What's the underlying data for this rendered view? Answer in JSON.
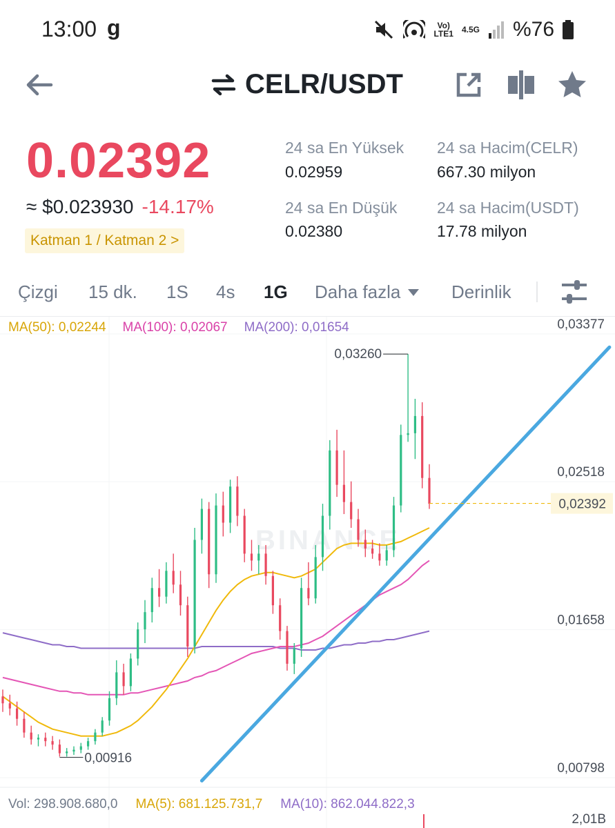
{
  "status_bar": {
    "time": "13:00",
    "carrier_icon": "g",
    "volte": "Vo)\nLTE1",
    "network": "4.5G",
    "battery": "%76",
    "icons": [
      "mute-icon",
      "hotspot-icon",
      "signal-icon",
      "battery-icon"
    ]
  },
  "header": {
    "pair": "CELR/USDT",
    "icons": [
      "back-arrow-icon",
      "swap-icon",
      "share-icon",
      "split-view-icon",
      "star-icon"
    ]
  },
  "price": {
    "last": "0.02392",
    "usd_equiv": "≈ $0.023930",
    "change_pct": "-14.17%",
    "layer_badge": "Katman 1 / Katman 2 >"
  },
  "stats": {
    "high_label": "24 sa En Yüksek",
    "high_value": "0.02959",
    "low_label": "24 sa En Düşük",
    "low_value": "0.02380",
    "vol_base_label": "24 sa Hacim(CELR)",
    "vol_base_value": "667.30 milyon",
    "vol_quote_label": "24 sa Hacim(USDT)",
    "vol_quote_value": "17.78 milyon"
  },
  "tabs": {
    "line": "Çizgi",
    "m15": "15 dk.",
    "h1": "1S",
    "h4": "4s",
    "d1": "1G",
    "more": "Daha fazla",
    "depth": "Derinlik",
    "active": "1G"
  },
  "ma_legend": {
    "ma50": "MA(50): 0,02244",
    "ma100": "MA(100): 0,02067",
    "ma200": "MA(200): 0,01654"
  },
  "chart_data": {
    "type": "candlestick",
    "watermark": "BINANCE",
    "y_ticks": [
      "0,03377",
      "0,02518",
      "0,01658",
      "0,00798"
    ],
    "y_tick_values": [
      0.03377,
      0.02518,
      0.01658,
      0.00798
    ],
    "ylim": [
      0.00798,
      0.03377
    ],
    "current_price_label": "0,02392",
    "current_price": 0.02392,
    "high_annotation": "0,03260",
    "high_value": 0.0326,
    "low_annotation": "0,00916",
    "low_value": 0.00916,
    "colors": {
      "up": "#2ebd85",
      "down": "#e9485f",
      "ma50": "#f0b90b",
      "ma100": "#e455b5",
      "ma200": "#8e6cc7",
      "trendline": "#4aa8e0"
    },
    "candles": [
      {
        "o": 0.0127,
        "h": 0.0131,
        "l": 0.0118,
        "c": 0.0123
      },
      {
        "o": 0.0123,
        "h": 0.0128,
        "l": 0.0116,
        "c": 0.012
      },
      {
        "o": 0.012,
        "h": 0.0124,
        "l": 0.011,
        "c": 0.0114
      },
      {
        "o": 0.0114,
        "h": 0.0118,
        "l": 0.0103,
        "c": 0.0106
      },
      {
        "o": 0.0106,
        "h": 0.011,
        "l": 0.0099,
        "c": 0.0102
      },
      {
        "o": 0.0102,
        "h": 0.0105,
        "l": 0.0098,
        "c": 0.0103
      },
      {
        "o": 0.0103,
        "h": 0.0106,
        "l": 0.0098,
        "c": 0.0101
      },
      {
        "o": 0.0101,
        "h": 0.0104,
        "l": 0.0096,
        "c": 0.0099
      },
      {
        "o": 0.0099,
        "h": 0.0102,
        "l": 0.0092,
        "c": 0.0094
      },
      {
        "o": 0.0094,
        "h": 0.0097,
        "l": 0.0092,
        "c": 0.0095
      },
      {
        "o": 0.0095,
        "h": 0.0098,
        "l": 0.0093,
        "c": 0.0096
      },
      {
        "o": 0.0096,
        "h": 0.01,
        "l": 0.0094,
        "c": 0.0098
      },
      {
        "o": 0.0098,
        "h": 0.0103,
        "l": 0.0096,
        "c": 0.0101
      },
      {
        "o": 0.0101,
        "h": 0.0108,
        "l": 0.0099,
        "c": 0.0106
      },
      {
        "o": 0.0106,
        "h": 0.0115,
        "l": 0.0104,
        "c": 0.0113
      },
      {
        "o": 0.0113,
        "h": 0.013,
        "l": 0.011,
        "c": 0.0126
      },
      {
        "o": 0.0126,
        "h": 0.0148,
        "l": 0.0122,
        "c": 0.0141
      },
      {
        "o": 0.0141,
        "h": 0.0146,
        "l": 0.0128,
        "c": 0.0133
      },
      {
        "o": 0.0133,
        "h": 0.0152,
        "l": 0.013,
        "c": 0.0149
      },
      {
        "o": 0.0149,
        "h": 0.017,
        "l": 0.0145,
        "c": 0.0166
      },
      {
        "o": 0.0166,
        "h": 0.0183,
        "l": 0.0158,
        "c": 0.0176
      },
      {
        "o": 0.0176,
        "h": 0.0196,
        "l": 0.017,
        "c": 0.019
      },
      {
        "o": 0.019,
        "h": 0.0201,
        "l": 0.0179,
        "c": 0.0185
      },
      {
        "o": 0.0185,
        "h": 0.0205,
        "l": 0.0181,
        "c": 0.02
      },
      {
        "o": 0.02,
        "h": 0.021,
        "l": 0.0187,
        "c": 0.0192
      },
      {
        "o": 0.0192,
        "h": 0.02,
        "l": 0.0174,
        "c": 0.018
      },
      {
        "o": 0.018,
        "h": 0.0185,
        "l": 0.015,
        "c": 0.0156
      },
      {
        "o": 0.0156,
        "h": 0.0225,
        "l": 0.0152,
        "c": 0.0218
      },
      {
        "o": 0.0218,
        "h": 0.0242,
        "l": 0.021,
        "c": 0.0236
      },
      {
        "o": 0.0236,
        "h": 0.024,
        "l": 0.019,
        "c": 0.0198
      },
      {
        "o": 0.0198,
        "h": 0.0245,
        "l": 0.0193,
        "c": 0.0238
      },
      {
        "o": 0.0238,
        "h": 0.0246,
        "l": 0.022,
        "c": 0.0228
      },
      {
        "o": 0.0228,
        "h": 0.0253,
        "l": 0.0222,
        "c": 0.0249
      },
      {
        "o": 0.0249,
        "h": 0.0255,
        "l": 0.0226,
        "c": 0.0232
      },
      {
        "o": 0.0232,
        "h": 0.0236,
        "l": 0.0205,
        "c": 0.021
      },
      {
        "o": 0.021,
        "h": 0.0218,
        "l": 0.02,
        "c": 0.0206
      },
      {
        "o": 0.0206,
        "h": 0.0215,
        "l": 0.0198,
        "c": 0.021
      },
      {
        "o": 0.021,
        "h": 0.0215,
        "l": 0.0192,
        "c": 0.0197
      },
      {
        "o": 0.0197,
        "h": 0.02,
        "l": 0.0175,
        "c": 0.018
      },
      {
        "o": 0.018,
        "h": 0.0184,
        "l": 0.016,
        "c": 0.0165
      },
      {
        "o": 0.0165,
        "h": 0.0168,
        "l": 0.0142,
        "c": 0.0146
      },
      {
        "o": 0.0146,
        "h": 0.0158,
        "l": 0.014,
        "c": 0.0155
      },
      {
        "o": 0.0155,
        "h": 0.0196,
        "l": 0.015,
        "c": 0.019
      },
      {
        "o": 0.019,
        "h": 0.0205,
        "l": 0.018,
        "c": 0.0184
      },
      {
        "o": 0.0184,
        "h": 0.0215,
        "l": 0.0181,
        "c": 0.0208
      },
      {
        "o": 0.0208,
        "h": 0.0239,
        "l": 0.02,
        "c": 0.0232
      },
      {
        "o": 0.0232,
        "h": 0.0276,
        "l": 0.0224,
        "c": 0.027
      },
      {
        "o": 0.027,
        "h": 0.0282,
        "l": 0.0243,
        "c": 0.025
      },
      {
        "o": 0.025,
        "h": 0.027,
        "l": 0.0233,
        "c": 0.024
      },
      {
        "o": 0.024,
        "h": 0.0252,
        "l": 0.0225,
        "c": 0.023
      },
      {
        "o": 0.023,
        "h": 0.0236,
        "l": 0.0214,
        "c": 0.0218
      },
      {
        "o": 0.0218,
        "h": 0.0224,
        "l": 0.0208,
        "c": 0.0213
      },
      {
        "o": 0.0213,
        "h": 0.0218,
        "l": 0.0207,
        "c": 0.021
      },
      {
        "o": 0.021,
        "h": 0.0216,
        "l": 0.0203,
        "c": 0.0206
      },
      {
        "o": 0.0206,
        "h": 0.0215,
        "l": 0.0203,
        "c": 0.0212
      },
      {
        "o": 0.0212,
        "h": 0.0243,
        "l": 0.0208,
        "c": 0.0238
      },
      {
        "o": 0.0238,
        "h": 0.0285,
        "l": 0.0234,
        "c": 0.0279
      },
      {
        "o": 0.0279,
        "h": 0.0326,
        "l": 0.0275,
        "c": 0.028
      },
      {
        "o": 0.028,
        "h": 0.03,
        "l": 0.0265,
        "c": 0.029
      },
      {
        "o": 0.029,
        "h": 0.0298,
        "l": 0.0248,
        "c": 0.0254
      },
      {
        "o": 0.0254,
        "h": 0.0262,
        "l": 0.0236,
        "c": 0.0239
      }
    ],
    "ma50_points": [
      0.0127,
      0.0124,
      0.0121,
      0.0118,
      0.0115,
      0.0112,
      0.011,
      0.0108,
      0.0107,
      0.0106,
      0.0105,
      0.0104,
      0.0104,
      0.0104,
      0.0104,
      0.0105,
      0.0106,
      0.0108,
      0.011,
      0.0113,
      0.0117,
      0.0121,
      0.0126,
      0.0131,
      0.0137,
      0.0143,
      0.0149,
      0.0156,
      0.0163,
      0.017,
      0.0177,
      0.0183,
      0.0188,
      0.0192,
      0.0195,
      0.0197,
      0.0198,
      0.0199,
      0.0199,
      0.0198,
      0.0197,
      0.0196,
      0.0197,
      0.0199,
      0.0201,
      0.0205,
      0.0209,
      0.0213,
      0.0215,
      0.0216,
      0.0216,
      0.0216,
      0.0216,
      0.0215,
      0.0215,
      0.0216,
      0.0217,
      0.0219,
      0.0221,
      0.0223,
      0.0225
    ],
    "ma100_points": [
      0.0138,
      0.0137,
      0.0136,
      0.0135,
      0.0134,
      0.0133,
      0.0132,
      0.0131,
      0.013,
      0.013,
      0.0129,
      0.0129,
      0.0128,
      0.0128,
      0.0128,
      0.0128,
      0.0128,
      0.0128,
      0.0129,
      0.0129,
      0.013,
      0.0131,
      0.0132,
      0.0133,
      0.0134,
      0.0135,
      0.0136,
      0.0138,
      0.0139,
      0.0141,
      0.0142,
      0.0144,
      0.0146,
      0.0148,
      0.015,
      0.0152,
      0.0153,
      0.0154,
      0.0155,
      0.0156,
      0.0156,
      0.0156,
      0.0157,
      0.0158,
      0.016,
      0.0162,
      0.0165,
      0.0168,
      0.0171,
      0.0174,
      0.0177,
      0.018,
      0.0183,
      0.0186,
      0.0188,
      0.019,
      0.0192,
      0.0195,
      0.0199,
      0.0203,
      0.0206
    ],
    "ma200_points": [
      0.0164,
      0.0163,
      0.0162,
      0.0161,
      0.016,
      0.0159,
      0.0158,
      0.0157,
      0.0157,
      0.0156,
      0.0156,
      0.0155,
      0.0155,
      0.0155,
      0.0155,
      0.0155,
      0.0155,
      0.0155,
      0.0155,
      0.0155,
      0.0155,
      0.0155,
      0.0155,
      0.0155,
      0.0155,
      0.0155,
      0.0155,
      0.0155,
      0.0156,
      0.0156,
      0.0156,
      0.0156,
      0.0156,
      0.0156,
      0.0156,
      0.0156,
      0.0156,
      0.0156,
      0.0156,
      0.0155,
      0.0155,
      0.0155,
      0.0154,
      0.0154,
      0.0154,
      0.0155,
      0.0155,
      0.0156,
      0.0157,
      0.0157,
      0.0158,
      0.0158,
      0.0159,
      0.0159,
      0.016,
      0.016,
      0.0161,
      0.0162,
      0.0163,
      0.0164,
      0.0165
    ],
    "trendline": {
      "start": {
        "candle": 18,
        "price": 0.0078
      },
      "end": {
        "candle": 73,
        "price": 0.033
      }
    }
  },
  "volume_legend": {
    "vol": "Vol: 298.908.680,0",
    "ma5": "MA(5): 681.125.731,7",
    "ma10": "MA(10): 862.044.822,3",
    "scale": "2,01B"
  }
}
